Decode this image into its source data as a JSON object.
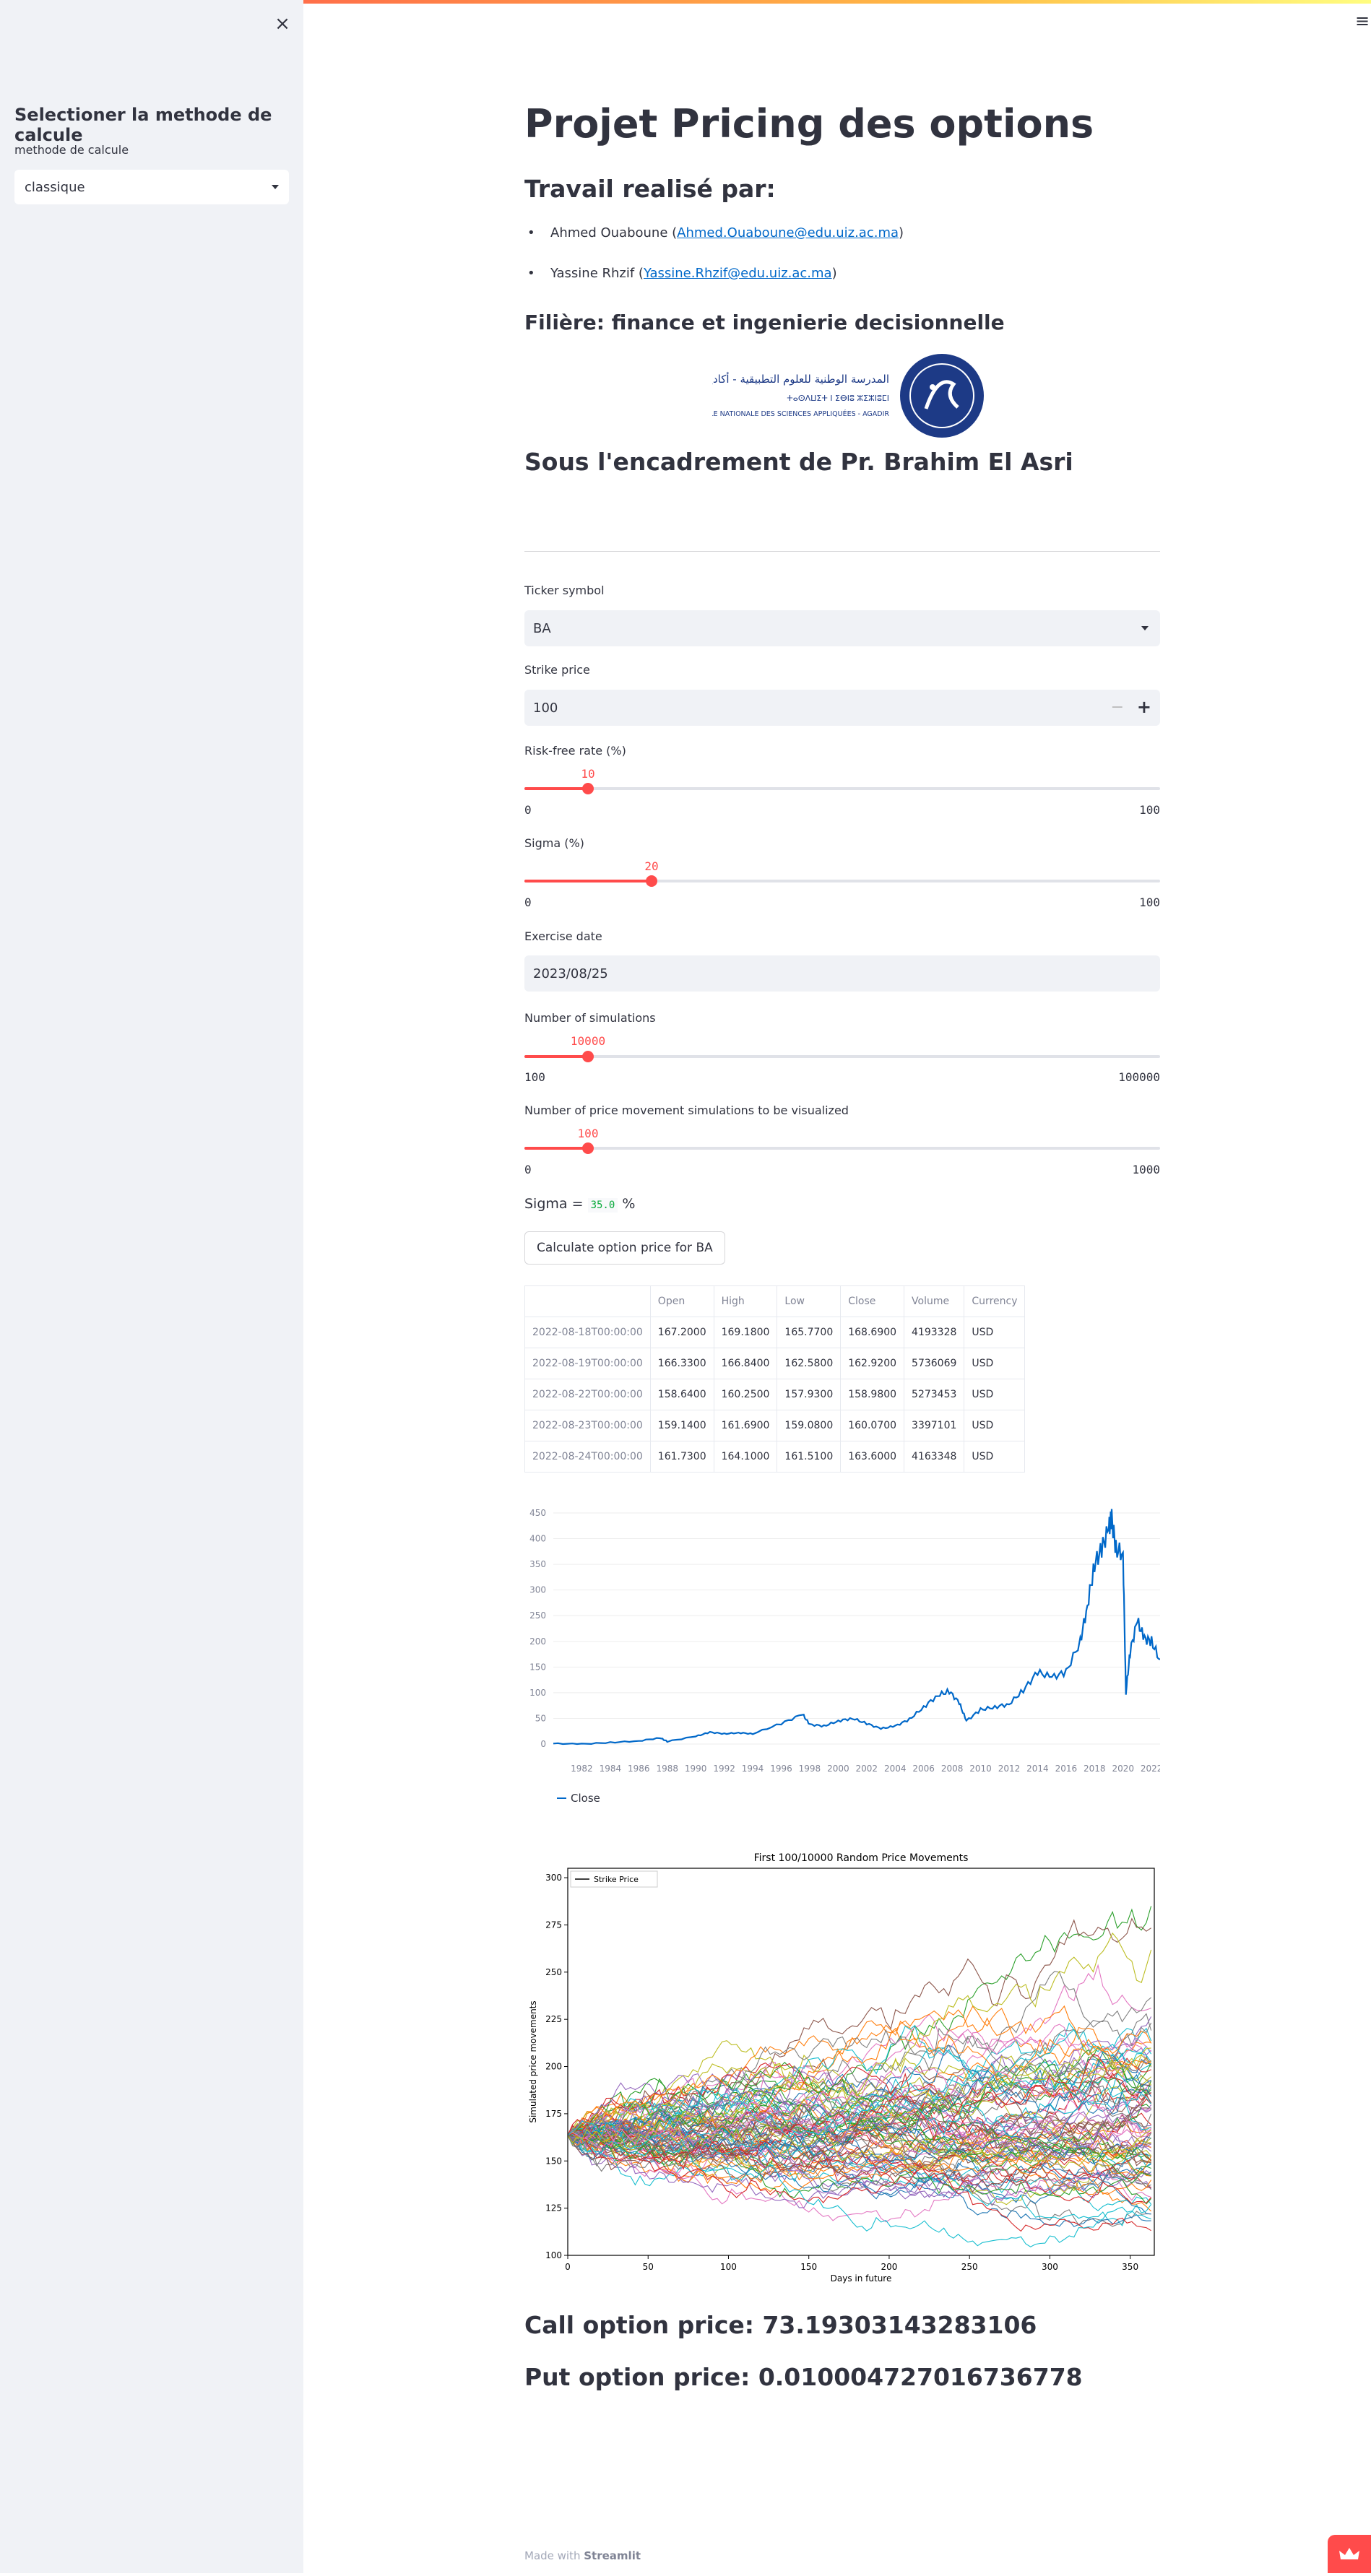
{
  "sidebar": {
    "title": "Selectioner la methode de calcule",
    "method_label": "methode de calcule",
    "method_value": "classique"
  },
  "main": {
    "title": "Projet Pricing des options",
    "work_by": "Travail realisé par:",
    "authors": [
      {
        "name": "Ahmed Ouaboune (",
        "email": "Ahmed.Ouaboune@edu.uiz.ac.ma",
        "close": ")"
      },
      {
        "name": "Yassine Rhzif (",
        "email": "Yassine.Rhzif@edu.uiz.ac.ma",
        "close": ")"
      }
    ],
    "filiere": "Filière: finance et ingenierie decisionnelle",
    "logo": {
      "arabic": "المدرسة الوطنية للعلوم التطبيقية - أكادير",
      "tifinagh": "ⵜⴰⵙⴷⵡⵉⵜ ⵏ ⵉⴱⵏⵓ ⵣⵉⵣⵏⵓⵎⵏ",
      "french": "ÉCOLE NATIONALE DES SCIENCES APPLIQUÉES - AGADIR"
    },
    "supervisor": "Sous l'encadrement de Pr. Brahim El Asri"
  },
  "form": {
    "ticker_label": "Ticker symbol",
    "ticker_value": "BA",
    "strike_label": "Strike price",
    "strike_value": "100",
    "strike_minus": "−",
    "strike_plus": "+",
    "rate": {
      "label": "Risk-free rate (%)",
      "value": "10",
      "min": "0",
      "max": "100",
      "fraction": 0.1
    },
    "sigma": {
      "label": "Sigma (%)",
      "value": "20",
      "min": "0",
      "max": "100",
      "fraction": 0.2
    },
    "date_label": "Exercise date",
    "date_value": "2023/08/25",
    "sims": {
      "label": "Number of simulations",
      "value": "10000",
      "min": "100",
      "max": "100000",
      "fraction": 0.1
    },
    "viz": {
      "label": "Number of price movement simulations to be visualized",
      "value": "100",
      "min": "0",
      "max": "1000",
      "fraction": 0.1
    },
    "sigma_prefix": "Sigma = ",
    "sigma_value": "35.0",
    "sigma_suffix": " %",
    "button": "Calculate option price for BA"
  },
  "table": {
    "columns": [
      "",
      "Open",
      "High",
      "Low",
      "Close",
      "Volume",
      "Currency"
    ],
    "rows": [
      [
        "2022-08-18T00:00:00",
        "167.2000",
        "169.1800",
        "165.7700",
        "168.6900",
        "4193328",
        "USD"
      ],
      [
        "2022-08-19T00:00:00",
        "166.3300",
        "166.8400",
        "162.5800",
        "162.9200",
        "5736069",
        "USD"
      ],
      [
        "2022-08-22T00:00:00",
        "158.6400",
        "160.2500",
        "157.9300",
        "158.9800",
        "5273453",
        "USD"
      ],
      [
        "2022-08-23T00:00:00",
        "159.1400",
        "161.6900",
        "159.0800",
        "160.0700",
        "3397101",
        "USD"
      ],
      [
        "2022-08-24T00:00:00",
        "161.7300",
        "164.1000",
        "161.5100",
        "163.6000",
        "4163348",
        "USD"
      ]
    ]
  },
  "chart_data": [
    {
      "type": "line",
      "title": "",
      "xlabel": "",
      "ylabel": "",
      "ylim": [
        0,
        450
      ],
      "yticks": [
        "0",
        "50",
        "100",
        "150",
        "200",
        "250",
        "300",
        "350",
        "400",
        "450"
      ],
      "xticks": [
        "1982",
        "1984",
        "1986",
        "1988",
        "1990",
        "1992",
        "1994",
        "1996",
        "1998",
        "2000",
        "2002",
        "2004",
        "2006",
        "2008",
        "2010",
        "2012",
        "2014",
        "2016",
        "2018",
        "2020",
        "2022"
      ],
      "series": [
        {
          "name": "Close",
          "color": "#0068c9",
          "x": [
            1980.0,
            1982.0,
            1984.0,
            1986.0,
            1987.5,
            1988.0,
            1990.0,
            1991.0,
            1992.0,
            1993.0,
            1994.0,
            1996.0,
            1997.5,
            1998.0,
            1999.0,
            2000.0,
            2001.0,
            2002.0,
            2003.0,
            2004.0,
            2005.0,
            2006.0,
            2007.0,
            2007.8,
            2008.5,
            2009.0,
            2010.0,
            2011.0,
            2012.0,
            2013.0,
            2014.0,
            2015.0,
            2016.0,
            2017.0,
            2017.5,
            2018.0,
            2018.5,
            2019.0,
            2019.2,
            2019.5,
            2020.0,
            2020.2,
            2020.5,
            2021.0,
            2021.5,
            2022.0,
            2022.6
          ],
          "y": [
            1,
            0,
            3,
            6,
            12,
            5,
            15,
            23,
            20,
            22,
            20,
            40,
            58,
            38,
            35,
            45,
            50,
            40,
            30,
            35,
            48,
            72,
            95,
            103,
            80,
            45,
            67,
            72,
            78,
            105,
            140,
            130,
            140,
            200,
            270,
            350,
            380,
            420,
            440,
            380,
            370,
            100,
            180,
            240,
            205,
            200,
            162
          ]
        }
      ],
      "legend": "bottom-left"
    },
    {
      "type": "line",
      "title": "First 100/10000 Random Price Movements",
      "xlabel": "Days in future",
      "ylabel": "Simulated price movements",
      "xlim": [
        0,
        365
      ],
      "ylim": [
        100,
        305
      ],
      "xticks": [
        "0",
        "50",
        "100",
        "150",
        "200",
        "250",
        "300",
        "350"
      ],
      "yticks": [
        "100",
        "125",
        "150",
        "175",
        "200",
        "225",
        "250",
        "275",
        "300"
      ],
      "start_price": 163.6,
      "num_paths": 100,
      "legend_entries": [
        "Strike Price"
      ],
      "strike_price": 100,
      "legend": "top-left"
    }
  ],
  "results": {
    "call": "Call option price: 73.19303143283106",
    "put": "Put option price: 0.010004727016736778"
  },
  "footer": {
    "made_with": "Made with ",
    "brand": "Streamlit"
  }
}
